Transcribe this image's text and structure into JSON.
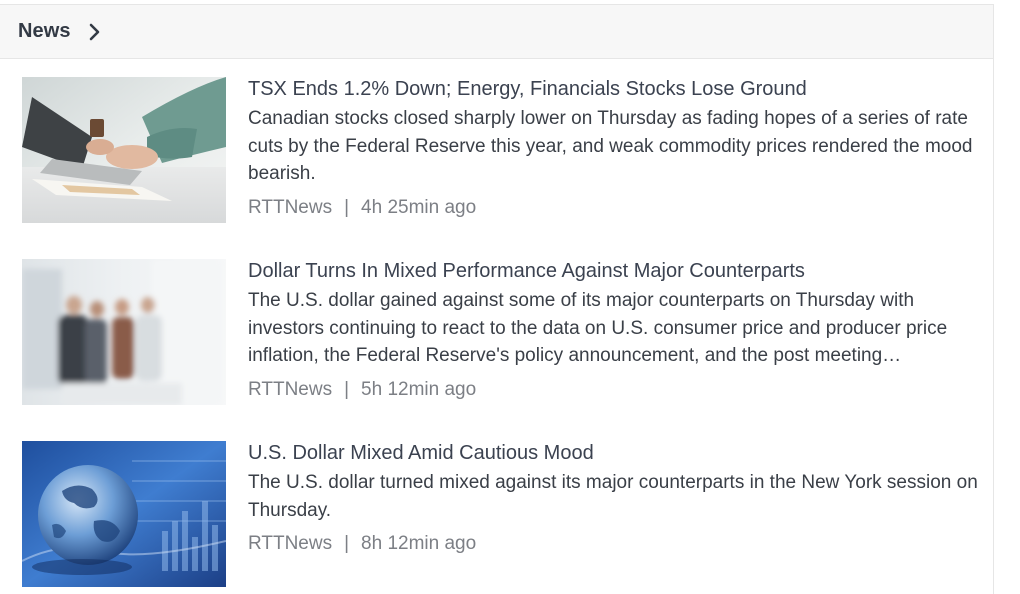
{
  "header": {
    "title": "News"
  },
  "articles": [
    {
      "title": "TSX Ends 1.2% Down; Energy, Financials Stocks Lose Ground",
      "summary": "Canadian stocks closed sharply lower on Thursday as fading hopes of a series of rate cuts by the Federal Reserve this year, and weak commodity prices rendered the mood bearish.",
      "source": "RTTNews",
      "separator": "|",
      "time": "4h 25min ago"
    },
    {
      "title": "Dollar Turns In Mixed Performance Against Major Counterparts",
      "summary": "The U.S. dollar gained against some of its major counterparts on Thursday with investors continuing to react to the data on U.S. consumer price and producer price inflation, the Federal Reserve's policy announcement, and the post meeting…",
      "source": "RTTNews",
      "separator": "|",
      "time": "5h 12min ago"
    },
    {
      "title": "U.S. Dollar Mixed Amid Cautious Mood",
      "summary": "The U.S. dollar turned mixed against its major counterparts in the New York session on Thursday.",
      "source": "RTTNews",
      "separator": "|",
      "time": "8h 12min ago"
    }
  ]
}
